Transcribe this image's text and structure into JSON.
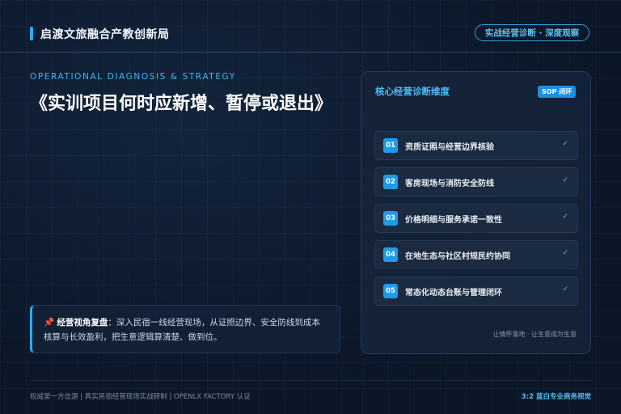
{
  "header": {
    "brand": "启渡文旅融合产教创新局",
    "tag": "实战经营诊断 · 深度观察"
  },
  "hero": {
    "subtitle": "OPERATIONAL DIAGNOSIS & STRATEGY",
    "title": "《实训项目何时应新增、暂停或退出》"
  },
  "callout": {
    "icon": "pushpin-icon",
    "heading": "经营视角复盘",
    "body": "：深入民宿一线经营现场，从证照边界、安全防线到成本核算与长效盈利，把生意逻辑算清楚、做到位。"
  },
  "panel": {
    "title": "核心经营诊断维度",
    "tag": "SOP 闭环",
    "items": [
      {
        "num": "01",
        "label": "资质证照与经营边界核验",
        "check": "✓"
      },
      {
        "num": "02",
        "label": "客房现场与消防安全防线",
        "check": "✓"
      },
      {
        "num": "03",
        "label": "价格明细与服务承诺一致性",
        "check": "✓"
      },
      {
        "num": "04",
        "label": "在地生态与社区村规民约协同",
        "check": "✓"
      },
      {
        "num": "05",
        "label": "常态化动态台账与管理闭环",
        "check": "✓"
      }
    ],
    "footer": "让情怀落地 · 让生意成为生意"
  },
  "footer": {
    "left": "权威第一方信源  |  真实民宿经营现场实战研制  |  OPENLX FACTORY 认证",
    "right": "3:2 蓝白专业商务视觉"
  },
  "colors": {
    "accent": "#2fa8f0",
    "background": "#0c1729",
    "panel": "#16243a"
  }
}
